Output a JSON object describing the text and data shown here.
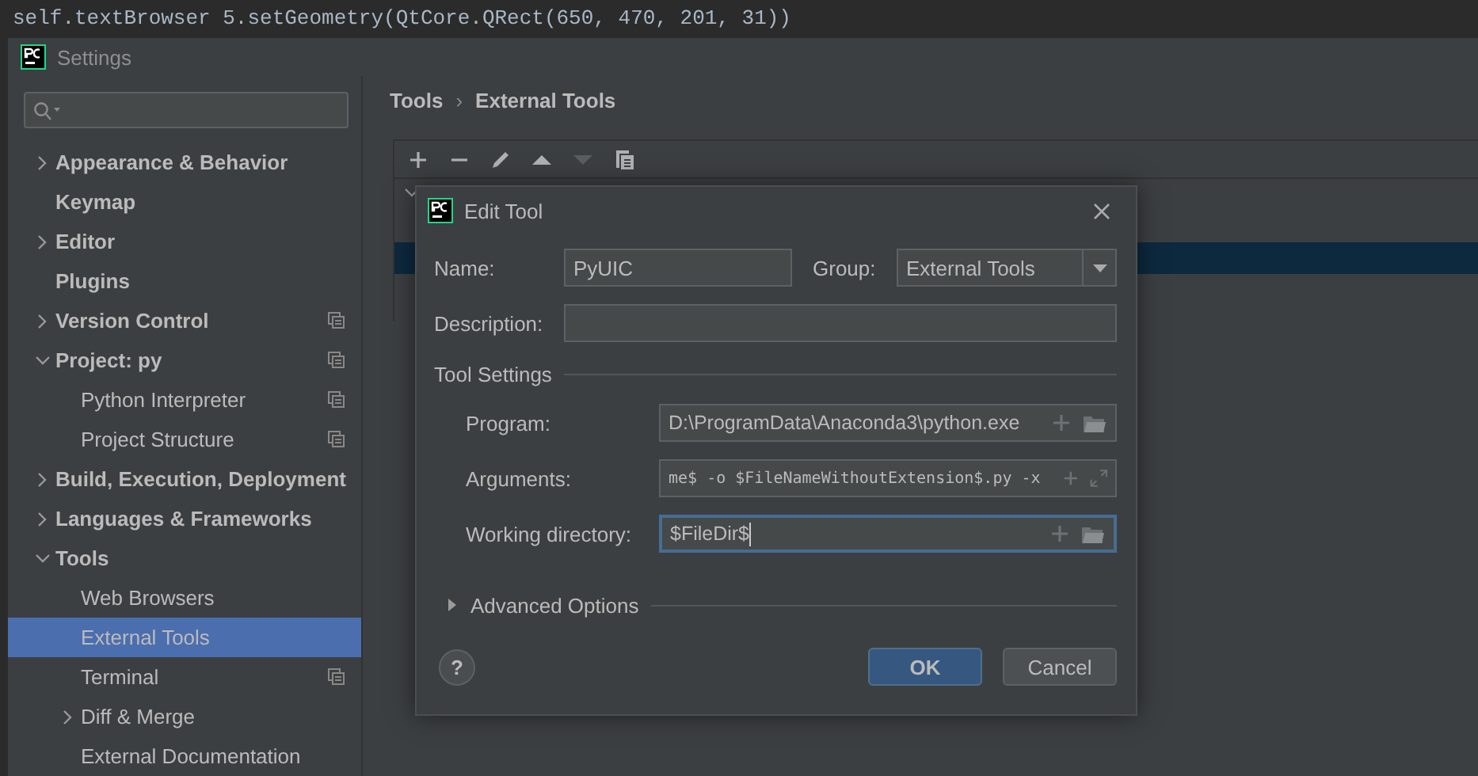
{
  "editor": {
    "code_line": "self.textBrowser 5.setGeometry(QtCore.QRect(650, 470, 201, 31))"
  },
  "window": {
    "title": "Settings"
  },
  "sidebar": {
    "items": [
      {
        "label": "Appearance & Behavior",
        "expanded": false,
        "scoped": false,
        "selected": false
      },
      {
        "label": "Keymap",
        "scoped": false,
        "selected": false
      },
      {
        "label": "Editor",
        "expanded": false,
        "scoped": false,
        "selected": false
      },
      {
        "label": "Plugins",
        "scoped": false,
        "selected": false
      },
      {
        "label": "Version Control",
        "expanded": false,
        "scoped": true,
        "selected": false
      },
      {
        "label": "Project: py",
        "expanded": true,
        "scoped": true,
        "selected": false,
        "children": [
          {
            "label": "Python Interpreter",
            "scoped": true,
            "selected": false
          },
          {
            "label": "Project Structure",
            "scoped": true,
            "selected": false
          }
        ]
      },
      {
        "label": "Build, Execution, Deployment",
        "expanded": false,
        "scoped": false,
        "selected": false
      },
      {
        "label": "Languages & Frameworks",
        "expanded": false,
        "scoped": false,
        "selected": false
      },
      {
        "label": "Tools",
        "expanded": true,
        "scoped": false,
        "selected": false,
        "children": [
          {
            "label": "Web Browsers",
            "scoped": false,
            "selected": false
          },
          {
            "label": "External Tools",
            "scoped": false,
            "selected": true
          },
          {
            "label": "Terminal",
            "scoped": true,
            "selected": false
          },
          {
            "label": "Diff & Merge",
            "expanded": false,
            "scoped": false,
            "selected": false
          },
          {
            "label": "External Documentation",
            "scoped": false,
            "selected": false
          }
        ]
      }
    ]
  },
  "breadcrumb": {
    "parts": [
      "Tools",
      "External Tools"
    ],
    "separator": "›"
  },
  "toolbar": [
    {
      "kind": "add",
      "disabled": false
    },
    {
      "kind": "remove",
      "disabled": false
    },
    {
      "kind": "edit",
      "disabled": false
    },
    {
      "kind": "up",
      "disabled": false
    },
    {
      "kind": "down",
      "disabled": true
    },
    {
      "kind": "copy",
      "disabled": false
    }
  ],
  "tool_tree": {
    "rows": [
      {
        "kind": "group",
        "expanded": true,
        "selected": false
      },
      {
        "kind": "tool",
        "selected": true
      }
    ]
  },
  "dialog": {
    "title": "Edit Tool",
    "name": {
      "label": "Name:",
      "value": "PyUIC"
    },
    "group": {
      "label": "Group:",
      "value": "External Tools"
    },
    "description": {
      "label": "Description:"
    },
    "section": "Tool Settings",
    "settings": [
      {
        "label": "Program:",
        "value": "D:\\ProgramData\\Anaconda3\\python.exe",
        "kind": "browse",
        "monospace": false,
        "focused": false
      },
      {
        "label": "Arguments:",
        "value": "me$ -o $FileNameWithoutExtension$.py -x",
        "kind": "expand",
        "monospace": true,
        "focused": false
      },
      {
        "label": "Working directory:",
        "value": "$FileDir$",
        "kind": "browse",
        "monospace": false,
        "focused": true
      }
    ],
    "advanced": {
      "label": "Advanced Options",
      "expanded": false
    },
    "help": "?",
    "buttons": [
      {
        "label": "OK",
        "default": true
      },
      {
        "label": "Cancel",
        "default": false
      }
    ]
  }
}
